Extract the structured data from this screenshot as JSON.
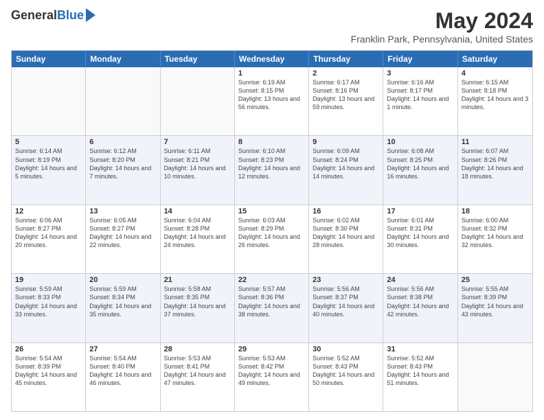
{
  "logo": {
    "general": "General",
    "blue": "Blue"
  },
  "title": "May 2024",
  "location": "Franklin Park, Pennsylvania, United States",
  "dayHeaders": [
    "Sunday",
    "Monday",
    "Tuesday",
    "Wednesday",
    "Thursday",
    "Friday",
    "Saturday"
  ],
  "rows": [
    {
      "alt": false,
      "cells": [
        {
          "date": "",
          "sunrise": "",
          "sunset": "",
          "daylight": ""
        },
        {
          "date": "",
          "sunrise": "",
          "sunset": "",
          "daylight": ""
        },
        {
          "date": "",
          "sunrise": "",
          "sunset": "",
          "daylight": ""
        },
        {
          "date": "1",
          "sunrise": "Sunrise: 6:19 AM",
          "sunset": "Sunset: 8:15 PM",
          "daylight": "Daylight: 13 hours and 56 minutes."
        },
        {
          "date": "2",
          "sunrise": "Sunrise: 6:17 AM",
          "sunset": "Sunset: 8:16 PM",
          "daylight": "Daylight: 13 hours and 59 minutes."
        },
        {
          "date": "3",
          "sunrise": "Sunrise: 6:16 AM",
          "sunset": "Sunset: 8:17 PM",
          "daylight": "Daylight: 14 hours and 1 minute."
        },
        {
          "date": "4",
          "sunrise": "Sunrise: 6:15 AM",
          "sunset": "Sunset: 8:18 PM",
          "daylight": "Daylight: 14 hours and 3 minutes."
        }
      ]
    },
    {
      "alt": true,
      "cells": [
        {
          "date": "5",
          "sunrise": "Sunrise: 6:14 AM",
          "sunset": "Sunset: 8:19 PM",
          "daylight": "Daylight: 14 hours and 5 minutes."
        },
        {
          "date": "6",
          "sunrise": "Sunrise: 6:12 AM",
          "sunset": "Sunset: 8:20 PM",
          "daylight": "Daylight: 14 hours and 7 minutes."
        },
        {
          "date": "7",
          "sunrise": "Sunrise: 6:11 AM",
          "sunset": "Sunset: 8:21 PM",
          "daylight": "Daylight: 14 hours and 10 minutes."
        },
        {
          "date": "8",
          "sunrise": "Sunrise: 6:10 AM",
          "sunset": "Sunset: 8:23 PM",
          "daylight": "Daylight: 14 hours and 12 minutes."
        },
        {
          "date": "9",
          "sunrise": "Sunrise: 6:09 AM",
          "sunset": "Sunset: 8:24 PM",
          "daylight": "Daylight: 14 hours and 14 minutes."
        },
        {
          "date": "10",
          "sunrise": "Sunrise: 6:08 AM",
          "sunset": "Sunset: 8:25 PM",
          "daylight": "Daylight: 14 hours and 16 minutes."
        },
        {
          "date": "11",
          "sunrise": "Sunrise: 6:07 AM",
          "sunset": "Sunset: 8:26 PM",
          "daylight": "Daylight: 14 hours and 18 minutes."
        }
      ]
    },
    {
      "alt": false,
      "cells": [
        {
          "date": "12",
          "sunrise": "Sunrise: 6:06 AM",
          "sunset": "Sunset: 8:27 PM",
          "daylight": "Daylight: 14 hours and 20 minutes."
        },
        {
          "date": "13",
          "sunrise": "Sunrise: 6:05 AM",
          "sunset": "Sunset: 8:27 PM",
          "daylight": "Daylight: 14 hours and 22 minutes."
        },
        {
          "date": "14",
          "sunrise": "Sunrise: 6:04 AM",
          "sunset": "Sunset: 8:28 PM",
          "daylight": "Daylight: 14 hours and 24 minutes."
        },
        {
          "date": "15",
          "sunrise": "Sunrise: 6:03 AM",
          "sunset": "Sunset: 8:29 PM",
          "daylight": "Daylight: 14 hours and 26 minutes."
        },
        {
          "date": "16",
          "sunrise": "Sunrise: 6:02 AM",
          "sunset": "Sunset: 8:30 PM",
          "daylight": "Daylight: 14 hours and 28 minutes."
        },
        {
          "date": "17",
          "sunrise": "Sunrise: 6:01 AM",
          "sunset": "Sunset: 8:31 PM",
          "daylight": "Daylight: 14 hours and 30 minutes."
        },
        {
          "date": "18",
          "sunrise": "Sunrise: 6:00 AM",
          "sunset": "Sunset: 8:32 PM",
          "daylight": "Daylight: 14 hours and 32 minutes."
        }
      ]
    },
    {
      "alt": true,
      "cells": [
        {
          "date": "19",
          "sunrise": "Sunrise: 5:59 AM",
          "sunset": "Sunset: 8:33 PM",
          "daylight": "Daylight: 14 hours and 33 minutes."
        },
        {
          "date": "20",
          "sunrise": "Sunrise: 5:59 AM",
          "sunset": "Sunset: 8:34 PM",
          "daylight": "Daylight: 14 hours and 35 minutes."
        },
        {
          "date": "21",
          "sunrise": "Sunrise: 5:58 AM",
          "sunset": "Sunset: 8:35 PM",
          "daylight": "Daylight: 14 hours and 37 minutes."
        },
        {
          "date": "22",
          "sunrise": "Sunrise: 5:57 AM",
          "sunset": "Sunset: 8:36 PM",
          "daylight": "Daylight: 14 hours and 38 minutes."
        },
        {
          "date": "23",
          "sunrise": "Sunrise: 5:56 AM",
          "sunset": "Sunset: 8:37 PM",
          "daylight": "Daylight: 14 hours and 40 minutes."
        },
        {
          "date": "24",
          "sunrise": "Sunrise: 5:56 AM",
          "sunset": "Sunset: 8:38 PM",
          "daylight": "Daylight: 14 hours and 42 minutes."
        },
        {
          "date": "25",
          "sunrise": "Sunrise: 5:55 AM",
          "sunset": "Sunset: 8:39 PM",
          "daylight": "Daylight: 14 hours and 43 minutes."
        }
      ]
    },
    {
      "alt": false,
      "cells": [
        {
          "date": "26",
          "sunrise": "Sunrise: 5:54 AM",
          "sunset": "Sunset: 8:39 PM",
          "daylight": "Daylight: 14 hours and 45 minutes."
        },
        {
          "date": "27",
          "sunrise": "Sunrise: 5:54 AM",
          "sunset": "Sunset: 8:40 PM",
          "daylight": "Daylight: 14 hours and 46 minutes."
        },
        {
          "date": "28",
          "sunrise": "Sunrise: 5:53 AM",
          "sunset": "Sunset: 8:41 PM",
          "daylight": "Daylight: 14 hours and 47 minutes."
        },
        {
          "date": "29",
          "sunrise": "Sunrise: 5:53 AM",
          "sunset": "Sunset: 8:42 PM",
          "daylight": "Daylight: 14 hours and 49 minutes."
        },
        {
          "date": "30",
          "sunrise": "Sunrise: 5:52 AM",
          "sunset": "Sunset: 8:43 PM",
          "daylight": "Daylight: 14 hours and 50 minutes."
        },
        {
          "date": "31",
          "sunrise": "Sunrise: 5:52 AM",
          "sunset": "Sunset: 8:43 PM",
          "daylight": "Daylight: 14 hours and 51 minutes."
        },
        {
          "date": "",
          "sunrise": "",
          "sunset": "",
          "daylight": ""
        }
      ]
    }
  ]
}
